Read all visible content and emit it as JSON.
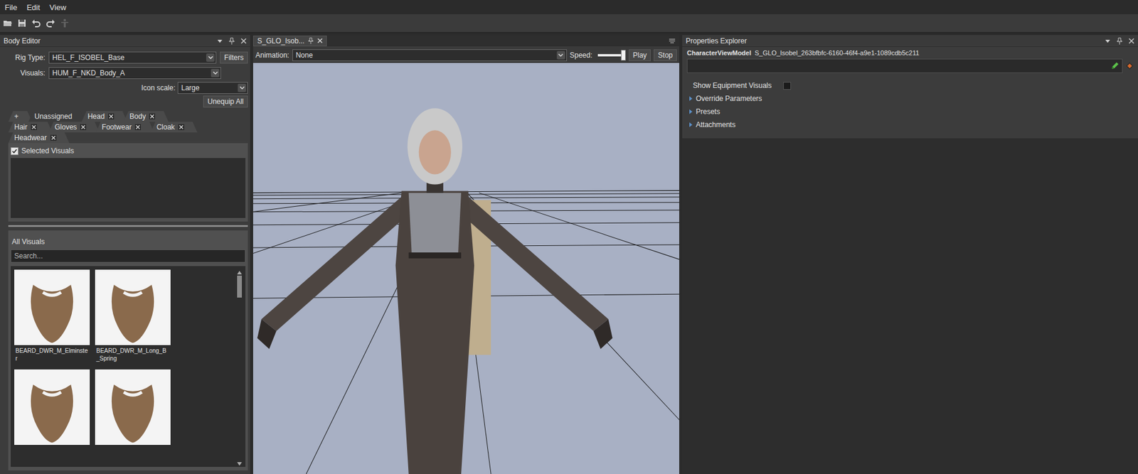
{
  "menu": [
    {
      "label": "File"
    },
    {
      "label": "Edit"
    },
    {
      "label": "View"
    }
  ],
  "toolbar": [
    {
      "disabled": false
    },
    {
      "disabled": false
    },
    {
      "disabled": false
    },
    {
      "disabled": false
    },
    {
      "disabled": true
    }
  ],
  "body_editor": {
    "title": "Body Editor",
    "fields": [
      {
        "label": "Rig Type:",
        "value": "HEL_F_ISOBEL_Base",
        "button": "Filters"
      },
      {
        "label": "Visuals:",
        "value": "HUM_F_NKD_Body_A",
        "button": ""
      }
    ],
    "icon_scale": {
      "label": "Icon scale:",
      "value": "Large"
    },
    "unequip": "Unequip All",
    "tab_rows": [
      [
        {
          "label": "+",
          "closable": false,
          "selected": false
        },
        {
          "label": "Unassigned",
          "closable": false,
          "selected": true
        },
        {
          "label": "Head",
          "closable": true,
          "selected": false
        },
        {
          "label": "Body",
          "closable": true,
          "selected": false
        }
      ],
      [
        {
          "label": "Hair",
          "closable": true,
          "selected": false
        },
        {
          "label": "Gloves",
          "closable": true,
          "selected": false
        },
        {
          "label": "Footwear",
          "closable": true,
          "selected": false
        },
        {
          "label": "Cloak",
          "closable": true,
          "selected": false
        }
      ],
      [
        {
          "label": "Headwear",
          "closable": true,
          "selected": false
        }
      ]
    ],
    "selected_visuals": {
      "label": "Selected Visuals",
      "checked": true
    },
    "all_visuals": {
      "label": "All Visuals",
      "search_placeholder": "Search...",
      "scroll_level": 0.12,
      "items": [
        {
          "label": "BEARD_DWR_M_Elminster"
        },
        {
          "label": "BEARD_DWR_M_Long_B_Spring"
        },
        {
          "label": ""
        },
        {
          "label": ""
        }
      ]
    }
  },
  "viewer": {
    "tab": {
      "label": "S_GLO_Isob...",
      "selected": true
    },
    "animation_label": "Animation:",
    "animation_value": "None",
    "speed_label": "Speed:",
    "speed_level": 1,
    "play": "Play",
    "stop": "Stop"
  },
  "properties": {
    "title": "Properties Explorer",
    "type": "CharacterViewModel",
    "name": "S_GLO_Isobel_263bfbfc-6160-46f4-a9e1-1089cdb5c211",
    "input_value": "",
    "show_equipment": {
      "label": "Show Equipment Visuals",
      "checked": false
    },
    "sections": [
      {
        "label": "Override Parameters",
        "expanded": false
      },
      {
        "label": "Presets",
        "expanded": false
      },
      {
        "label": "Attachments",
        "expanded": false
      }
    ]
  }
}
